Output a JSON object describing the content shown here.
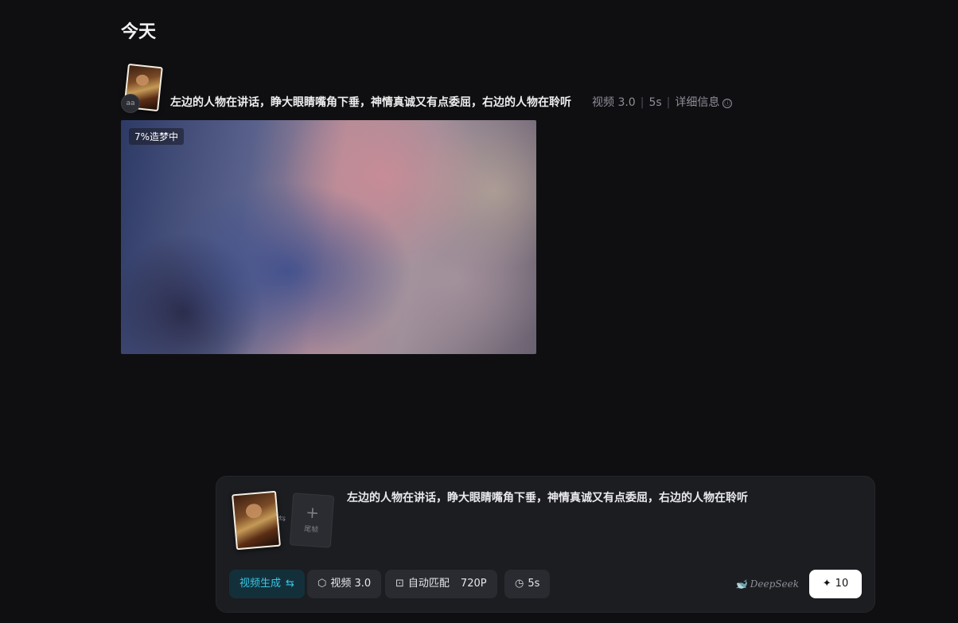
{
  "section_title": "今天",
  "generation": {
    "avatar_text": "aa",
    "prompt": "左边的人物在讲话，睁大眼睛嘴角下垂，神情真诚又有点委屈，右边的人物在聆听",
    "model": "视频 3.0",
    "duration": "5s",
    "details_label": "详细信息",
    "info_icon": "ⓘ",
    "progress_label": "7%造梦中",
    "progress_value": 7
  },
  "composer": {
    "swap_icon": "⇆",
    "end_frame_plus": "+",
    "end_frame_label": "尾帧",
    "prompt": "左边的人物在讲话，睁大眼睛嘴角下垂，神情真诚又有点委屈，右边的人物在聆听",
    "mode_label": "视频生成",
    "mode_icon": "⇆",
    "model_icon": "⬡",
    "model_label": "视频 3.0",
    "ratio_icon": "⊡",
    "ratio_label": "自动匹配",
    "resolution": "720P",
    "duration_icon": "◷",
    "duration": "5s",
    "provider_label": "DeepSeek",
    "submit_icon": "✦",
    "submit_count": "10"
  },
  "colors": {
    "background": "#0f0f12",
    "panel": "#1c1d21",
    "accent": "#38c6e6"
  }
}
